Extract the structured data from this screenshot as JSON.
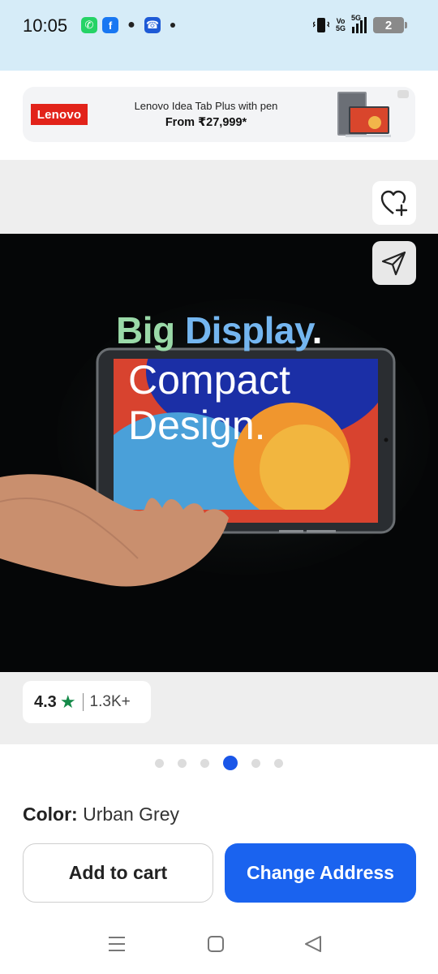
{
  "status_bar": {
    "time": "10:05",
    "signal_text_top": "Vo",
    "signal_text_bottom": "5G",
    "network": "5G",
    "battery": "2"
  },
  "ad": {
    "brand": "Lenovo",
    "line1": "Lenovo Idea Tab Plus with pen",
    "line2": "From ₹27,999*"
  },
  "hero": {
    "headline_big": "Big",
    "headline_display": "Display",
    "headline_dot": ".",
    "tagline_1": "Compact",
    "tagline_2": "Design."
  },
  "rating": {
    "value": "4.3",
    "count": "1.3K+"
  },
  "pager": {
    "total": 6,
    "active_index": 3
  },
  "color": {
    "label": "Color:",
    "value": "Urban Grey"
  },
  "actions": {
    "add_to_cart": "Add to cart",
    "change_address": "Change Address"
  },
  "colors": {
    "primary": "#1a63ef",
    "rating_star": "#148a48",
    "status_bg": "#d6ecf8",
    "lenovo_red": "#e2231a"
  },
  "icons": {
    "wishlist": "heart-plus-icon",
    "share": "send-icon",
    "nav_menu": "menu-icon",
    "nav_home": "square-icon",
    "nav_back": "back-triangle-icon"
  }
}
